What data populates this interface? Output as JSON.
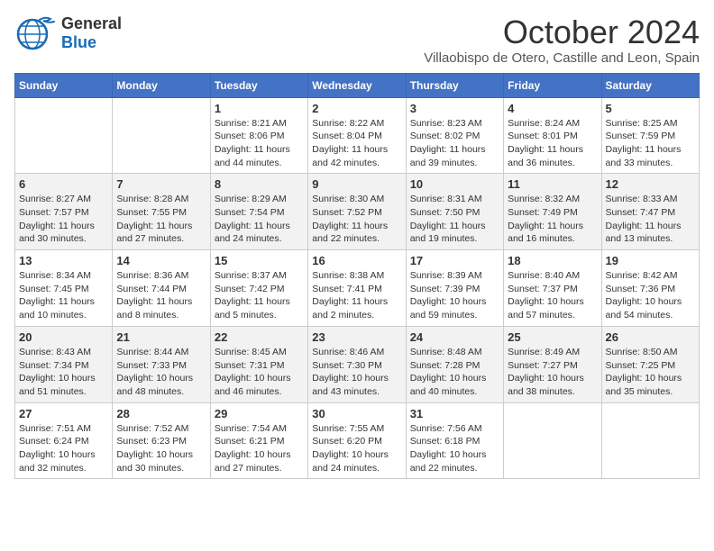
{
  "header": {
    "logo_line1": "General",
    "logo_line2": "Blue",
    "month_title": "October 2024",
    "subtitle": "Villaobispo de Otero, Castille and Leon, Spain"
  },
  "weekdays": [
    "Sunday",
    "Monday",
    "Tuesday",
    "Wednesday",
    "Thursday",
    "Friday",
    "Saturday"
  ],
  "weeks": [
    [
      {
        "day": "",
        "info": ""
      },
      {
        "day": "",
        "info": ""
      },
      {
        "day": "1",
        "info": "Sunrise: 8:21 AM\nSunset: 8:06 PM\nDaylight: 11 hours and 44 minutes."
      },
      {
        "day": "2",
        "info": "Sunrise: 8:22 AM\nSunset: 8:04 PM\nDaylight: 11 hours and 42 minutes."
      },
      {
        "day": "3",
        "info": "Sunrise: 8:23 AM\nSunset: 8:02 PM\nDaylight: 11 hours and 39 minutes."
      },
      {
        "day": "4",
        "info": "Sunrise: 8:24 AM\nSunset: 8:01 PM\nDaylight: 11 hours and 36 minutes."
      },
      {
        "day": "5",
        "info": "Sunrise: 8:25 AM\nSunset: 7:59 PM\nDaylight: 11 hours and 33 minutes."
      }
    ],
    [
      {
        "day": "6",
        "info": "Sunrise: 8:27 AM\nSunset: 7:57 PM\nDaylight: 11 hours and 30 minutes."
      },
      {
        "day": "7",
        "info": "Sunrise: 8:28 AM\nSunset: 7:55 PM\nDaylight: 11 hours and 27 minutes."
      },
      {
        "day": "8",
        "info": "Sunrise: 8:29 AM\nSunset: 7:54 PM\nDaylight: 11 hours and 24 minutes."
      },
      {
        "day": "9",
        "info": "Sunrise: 8:30 AM\nSunset: 7:52 PM\nDaylight: 11 hours and 22 minutes."
      },
      {
        "day": "10",
        "info": "Sunrise: 8:31 AM\nSunset: 7:50 PM\nDaylight: 11 hours and 19 minutes."
      },
      {
        "day": "11",
        "info": "Sunrise: 8:32 AM\nSunset: 7:49 PM\nDaylight: 11 hours and 16 minutes."
      },
      {
        "day": "12",
        "info": "Sunrise: 8:33 AM\nSunset: 7:47 PM\nDaylight: 11 hours and 13 minutes."
      }
    ],
    [
      {
        "day": "13",
        "info": "Sunrise: 8:34 AM\nSunset: 7:45 PM\nDaylight: 11 hours and 10 minutes."
      },
      {
        "day": "14",
        "info": "Sunrise: 8:36 AM\nSunset: 7:44 PM\nDaylight: 11 hours and 8 minutes."
      },
      {
        "day": "15",
        "info": "Sunrise: 8:37 AM\nSunset: 7:42 PM\nDaylight: 11 hours and 5 minutes."
      },
      {
        "day": "16",
        "info": "Sunrise: 8:38 AM\nSunset: 7:41 PM\nDaylight: 11 hours and 2 minutes."
      },
      {
        "day": "17",
        "info": "Sunrise: 8:39 AM\nSunset: 7:39 PM\nDaylight: 10 hours and 59 minutes."
      },
      {
        "day": "18",
        "info": "Sunrise: 8:40 AM\nSunset: 7:37 PM\nDaylight: 10 hours and 57 minutes."
      },
      {
        "day": "19",
        "info": "Sunrise: 8:42 AM\nSunset: 7:36 PM\nDaylight: 10 hours and 54 minutes."
      }
    ],
    [
      {
        "day": "20",
        "info": "Sunrise: 8:43 AM\nSunset: 7:34 PM\nDaylight: 10 hours and 51 minutes."
      },
      {
        "day": "21",
        "info": "Sunrise: 8:44 AM\nSunset: 7:33 PM\nDaylight: 10 hours and 48 minutes."
      },
      {
        "day": "22",
        "info": "Sunrise: 8:45 AM\nSunset: 7:31 PM\nDaylight: 10 hours and 46 minutes."
      },
      {
        "day": "23",
        "info": "Sunrise: 8:46 AM\nSunset: 7:30 PM\nDaylight: 10 hours and 43 minutes."
      },
      {
        "day": "24",
        "info": "Sunrise: 8:48 AM\nSunset: 7:28 PM\nDaylight: 10 hours and 40 minutes."
      },
      {
        "day": "25",
        "info": "Sunrise: 8:49 AM\nSunset: 7:27 PM\nDaylight: 10 hours and 38 minutes."
      },
      {
        "day": "26",
        "info": "Sunrise: 8:50 AM\nSunset: 7:25 PM\nDaylight: 10 hours and 35 minutes."
      }
    ],
    [
      {
        "day": "27",
        "info": "Sunrise: 7:51 AM\nSunset: 6:24 PM\nDaylight: 10 hours and 32 minutes."
      },
      {
        "day": "28",
        "info": "Sunrise: 7:52 AM\nSunset: 6:23 PM\nDaylight: 10 hours and 30 minutes."
      },
      {
        "day": "29",
        "info": "Sunrise: 7:54 AM\nSunset: 6:21 PM\nDaylight: 10 hours and 27 minutes."
      },
      {
        "day": "30",
        "info": "Sunrise: 7:55 AM\nSunset: 6:20 PM\nDaylight: 10 hours and 24 minutes."
      },
      {
        "day": "31",
        "info": "Sunrise: 7:56 AM\nSunset: 6:18 PM\nDaylight: 10 hours and 22 minutes."
      },
      {
        "day": "",
        "info": ""
      },
      {
        "day": "",
        "info": ""
      }
    ]
  ]
}
